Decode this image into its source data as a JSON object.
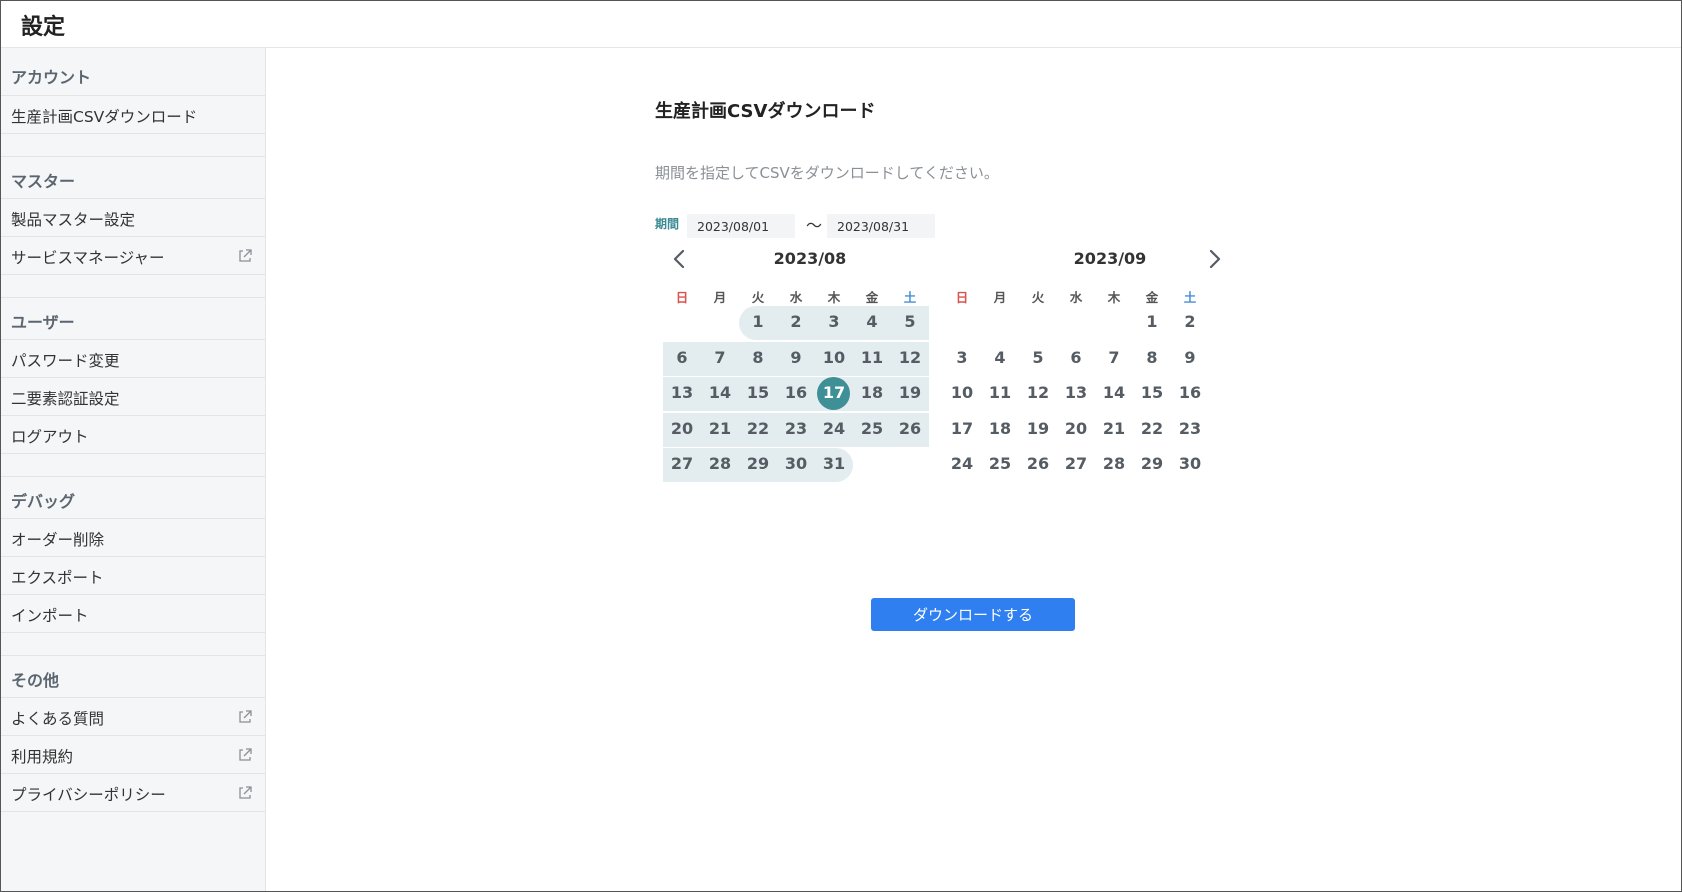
{
  "app": {
    "title": "設定"
  },
  "sidebar": {
    "sections": [
      {
        "heading": "アカウント",
        "items": [
          {
            "label": "生産計画CSVダウンロード",
            "external": false
          }
        ]
      },
      {
        "heading": "マスター",
        "items": [
          {
            "label": "製品マスター設定",
            "external": false
          },
          {
            "label": "サービスマネージャー",
            "external": true
          }
        ]
      },
      {
        "heading": "ユーザー",
        "items": [
          {
            "label": "パスワード変更",
            "external": false
          },
          {
            "label": "二要素認証設定",
            "external": false
          },
          {
            "label": "ログアウト",
            "external": false
          }
        ]
      },
      {
        "heading": "デバッグ",
        "items": [
          {
            "label": "オーダー削除",
            "external": false
          },
          {
            "label": "エクスポート",
            "external": false
          },
          {
            "label": "インポート",
            "external": false
          }
        ]
      },
      {
        "heading": "その他",
        "items": [
          {
            "label": "よくある質問",
            "external": true
          },
          {
            "label": "利用規約",
            "external": true
          },
          {
            "label": "プライバシーポリシー",
            "external": true
          }
        ]
      }
    ]
  },
  "main": {
    "title": "生産計画CSVダウンロード",
    "description": "期間を指定してCSVをダウンロードしてください。",
    "period": {
      "label": "期間",
      "start": "2023/08/01",
      "separator": "〜",
      "end": "2023/08/31"
    },
    "calendar": {
      "weekdays": [
        "日",
        "月",
        "火",
        "水",
        "木",
        "金",
        "土"
      ],
      "months": [
        {
          "title": "2023/08",
          "first_weekday": 2,
          "days": 31
        },
        {
          "title": "2023/09",
          "first_weekday": 5,
          "days": 30
        }
      ],
      "range": {
        "month": 0,
        "start": 1,
        "end": 31
      },
      "selected": {
        "month": 0,
        "day": 17
      }
    },
    "download_button": "ダウンロードする"
  },
  "colors": {
    "accent": "#3f8f96",
    "range_band": "#e3ecef",
    "button": "#2f7ff0",
    "sunday": "#d9534f",
    "saturday": "#4a90d9"
  }
}
